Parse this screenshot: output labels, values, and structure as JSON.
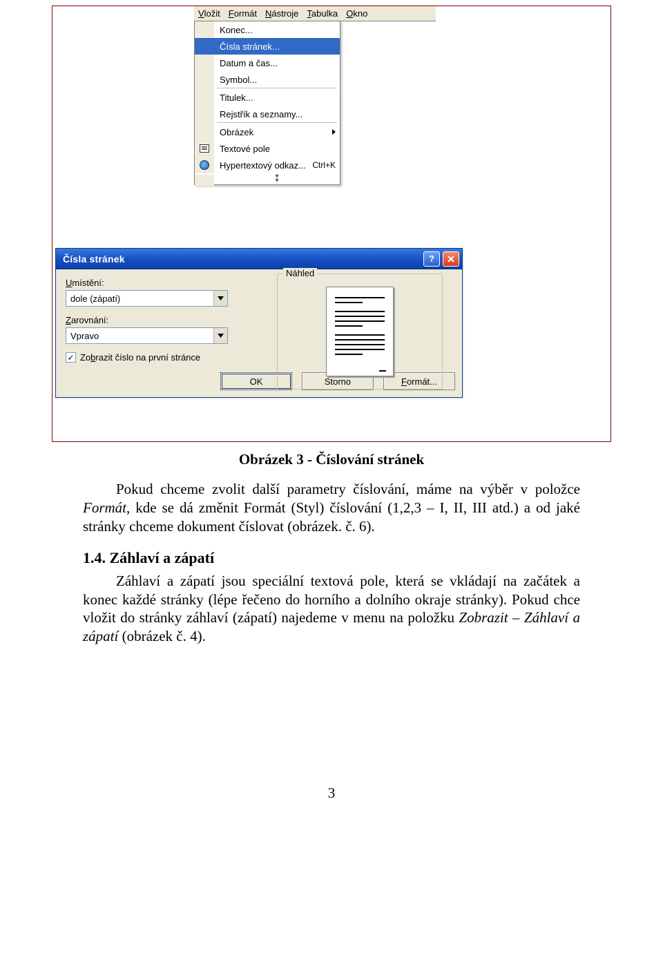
{
  "menubar": {
    "items": [
      "Vložit",
      "Formát",
      "Nástroje",
      "Tabulka",
      "Okno"
    ],
    "items_u": [
      "V",
      "F",
      "N",
      "T",
      "O"
    ]
  },
  "dropdown": {
    "items": [
      {
        "label": "Konec...",
        "u": "c",
        "selected": false
      },
      {
        "label": "Čísla stránek...",
        "u": "l",
        "selected": true
      },
      {
        "label": "Datum a čas...",
        "u": "a",
        "selected": false
      },
      {
        "label": "Symbol...",
        "u": "m",
        "selected": false
      }
    ],
    "group2": [
      {
        "label": "Titulek...",
        "u": "T"
      },
      {
        "label": "Rejstřík a seznamy...",
        "u": "j"
      }
    ],
    "group3": [
      {
        "label": "Obrázek",
        "u": "O",
        "submenu": true
      },
      {
        "label": "Textové pole",
        "u": "x",
        "icon": "textbox"
      },
      {
        "label": "Hypertextový odkaz...",
        "u": "z",
        "icon": "globe",
        "shortcut": "Ctrl+K"
      }
    ]
  },
  "dialog": {
    "title": "Čísla stránek",
    "labels": {
      "umisteni": "Umístění:",
      "zarovnani": "Zarovnání:"
    },
    "values": {
      "umisteni": "dole (zápatí)",
      "zarovnani": "Vpravo"
    },
    "checkbox_label": "Zobrazit číslo na první stránce",
    "checkbox_checked": true,
    "preview_label": "Náhled",
    "buttons": {
      "ok": "OK",
      "cancel": "Storno",
      "format": "Formát..."
    }
  },
  "document": {
    "caption": "Obrázek 3 - Číslování stránek",
    "para1_pre": "Pokud chceme zvolit další parametry číslování, máme na výběr v položce ",
    "para1_em": "Formát",
    "para1_post": ", kde se dá změnit Formát (Styl) číslování (1,2,3 – I, II, III atd.) a od jaké stránky chceme dokument číslovat (obrázek. č. 6).",
    "heading_num": "1.4.",
    "heading_text": "Záhlaví a zápatí",
    "para2_pre": "Záhlaví a zápatí jsou speciální textová pole, která se vkládají na začátek a konec každé stránky (lépe řečeno do horního a dolního okraje stránky). Pokud chce vložit do stránky záhlaví (zápatí) najedeme v menu na položku ",
    "para2_em": "Zobrazit – Záhlaví a zápatí",
    "para2_post": " (obrázek č. 4).",
    "page_number": "3"
  }
}
